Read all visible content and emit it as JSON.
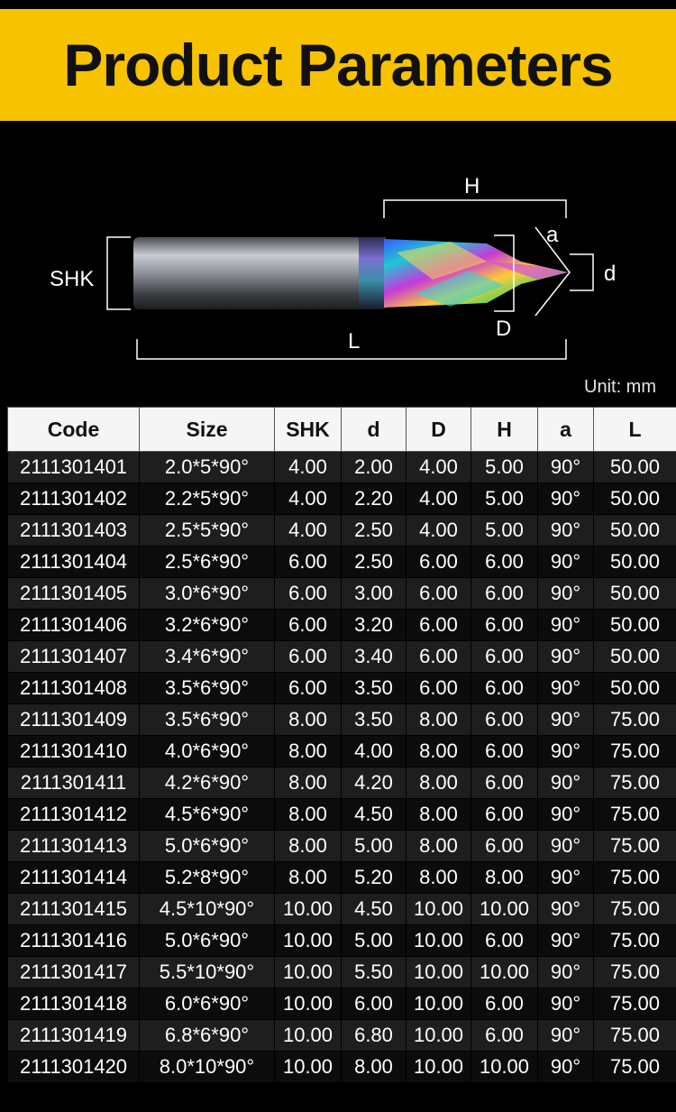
{
  "title": "Product Parameters",
  "diagram": {
    "labels": {
      "H": "H",
      "a": "a",
      "SHK": "SHK",
      "d": "d",
      "D": "D",
      "L": "L"
    }
  },
  "unit": "Unit: mm",
  "table": {
    "headers": [
      "Code",
      "Size",
      "SHK",
      "d",
      "D",
      "H",
      "a",
      "L"
    ],
    "rows": [
      [
        "2111301401",
        "2.0*5*90°",
        "4.00",
        "2.00",
        "4.00",
        "5.00",
        "90°",
        "50.00"
      ],
      [
        "2111301402",
        "2.2*5*90°",
        "4.00",
        "2.20",
        "4.00",
        "5.00",
        "90°",
        "50.00"
      ],
      [
        "2111301403",
        "2.5*5*90°",
        "4.00",
        "2.50",
        "4.00",
        "5.00",
        "90°",
        "50.00"
      ],
      [
        "2111301404",
        "2.5*6*90°",
        "6.00",
        "2.50",
        "6.00",
        "6.00",
        "90°",
        "50.00"
      ],
      [
        "2111301405",
        "3.0*6*90°",
        "6.00",
        "3.00",
        "6.00",
        "6.00",
        "90°",
        "50.00"
      ],
      [
        "2111301406",
        "3.2*6*90°",
        "6.00",
        "3.20",
        "6.00",
        "6.00",
        "90°",
        "50.00"
      ],
      [
        "2111301407",
        "3.4*6*90°",
        "6.00",
        "3.40",
        "6.00",
        "6.00",
        "90°",
        "50.00"
      ],
      [
        "2111301408",
        "3.5*6*90°",
        "6.00",
        "3.50",
        "6.00",
        "6.00",
        "90°",
        "50.00"
      ],
      [
        "2111301409",
        "3.5*6*90°",
        "8.00",
        "3.50",
        "8.00",
        "6.00",
        "90°",
        "75.00"
      ],
      [
        "2111301410",
        "4.0*6*90°",
        "8.00",
        "4.00",
        "8.00",
        "6.00",
        "90°",
        "75.00"
      ],
      [
        "2111301411",
        "4.2*6*90°",
        "8.00",
        "4.20",
        "8.00",
        "6.00",
        "90°",
        "75.00"
      ],
      [
        "2111301412",
        "4.5*6*90°",
        "8.00",
        "4.50",
        "8.00",
        "6.00",
        "90°",
        "75.00"
      ],
      [
        "2111301413",
        "5.0*6*90°",
        "8.00",
        "5.00",
        "8.00",
        "6.00",
        "90°",
        "75.00"
      ],
      [
        "2111301414",
        "5.2*8*90°",
        "8.00",
        "5.20",
        "8.00",
        "8.00",
        "90°",
        "75.00"
      ],
      [
        "2111301415",
        "4.5*10*90°",
        "10.00",
        "4.50",
        "10.00",
        "10.00",
        "90°",
        "75.00"
      ],
      [
        "2111301416",
        "5.0*6*90°",
        "10.00",
        "5.00",
        "10.00",
        "6.00",
        "90°",
        "75.00"
      ],
      [
        "2111301417",
        "5.5*10*90°",
        "10.00",
        "5.50",
        "10.00",
        "10.00",
        "90°",
        "75.00"
      ],
      [
        "2111301418",
        "6.0*6*90°",
        "10.00",
        "6.00",
        "10.00",
        "6.00",
        "90°",
        "75.00"
      ],
      [
        "2111301419",
        "6.8*6*90°",
        "10.00",
        "6.80",
        "10.00",
        "6.00",
        "90°",
        "75.00"
      ],
      [
        "2111301420",
        "8.0*10*90°",
        "10.00",
        "8.00",
        "10.00",
        "10.00",
        "90°",
        "75.00"
      ]
    ]
  }
}
